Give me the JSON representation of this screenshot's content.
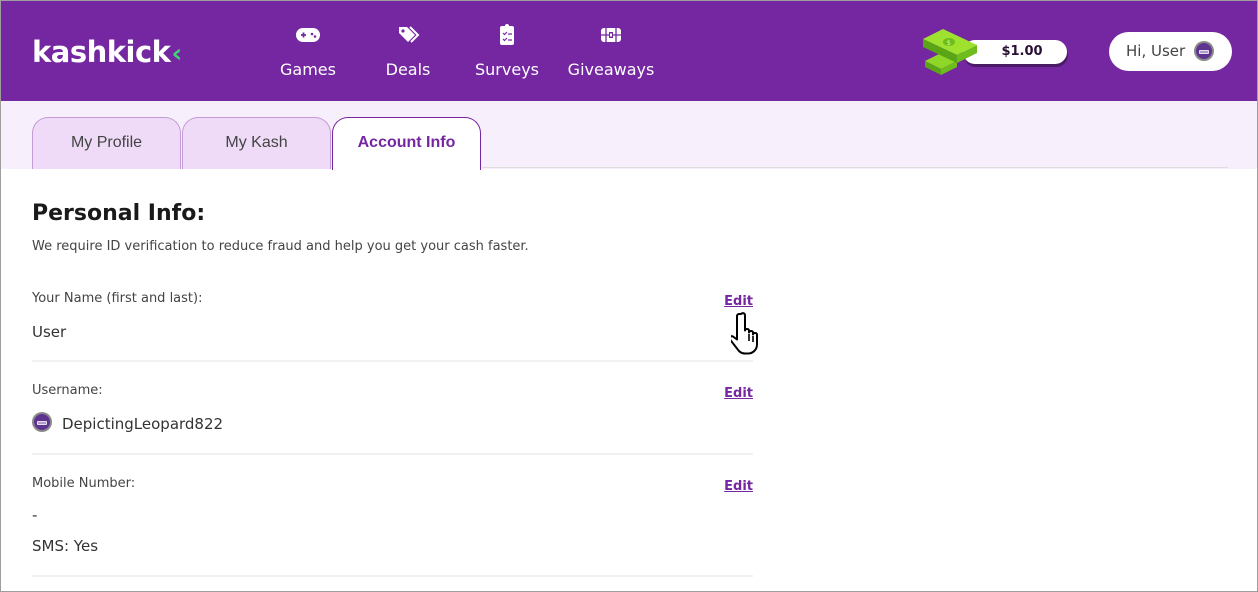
{
  "header": {
    "logo_text": "kashkick",
    "logo_chevron": "‹",
    "nav": [
      {
        "label": "Games",
        "icon": "gamepad-icon"
      },
      {
        "label": "Deals",
        "icon": "tags-icon"
      },
      {
        "label": "Surveys",
        "icon": "clipboard-check-icon"
      },
      {
        "label": "Giveaways",
        "icon": "treasure-chest-icon"
      }
    ],
    "balance": "$1.00",
    "greeting": "Hi, User"
  },
  "tabs": [
    {
      "label": "My Profile",
      "active": false
    },
    {
      "label": "My Kash",
      "active": false
    },
    {
      "label": "Account Info",
      "active": true
    }
  ],
  "section": {
    "title": "Personal Info:",
    "subtitle": "We require ID verification to reduce fraud and help you get your cash faster."
  },
  "fields": [
    {
      "label": "Your Name (first and last):",
      "value": "User",
      "edit": "Edit"
    },
    {
      "label": "Username:",
      "value": "DepictingLeopard822",
      "edit": "Edit"
    },
    {
      "label": "Mobile Number:",
      "value": "-",
      "extra": "SMS: Yes",
      "edit": "Edit"
    }
  ],
  "colors": {
    "brand": "#7427a1",
    "tab_strip": "#f8effc",
    "tab_inactive": "#efdbf7",
    "accent_green": "#3fd47a"
  }
}
